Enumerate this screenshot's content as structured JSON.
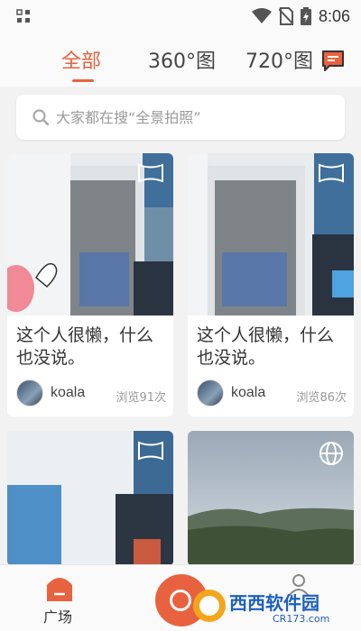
{
  "status_bar": {
    "time": "8:06"
  },
  "header": {
    "tabs": [
      {
        "label": "全部",
        "active": true
      },
      {
        "label": "360°图",
        "active": false
      },
      {
        "label": "720°图",
        "active": false
      }
    ],
    "accent_color": "#e8623f"
  },
  "search": {
    "placeholder": "大家都在搜“全景拍照”"
  },
  "cards": [
    {
      "caption": "这个人很懒，什么也没说。",
      "author": "koala",
      "views": "浏览91次"
    },
    {
      "caption": "这个人很懒，什么也没说。",
      "author": "koala",
      "views": "浏览86次"
    }
  ],
  "bottom_nav": {
    "home_label": "广场"
  },
  "watermark": {
    "brand": "西西软件园",
    "site": "CR173.com"
  }
}
